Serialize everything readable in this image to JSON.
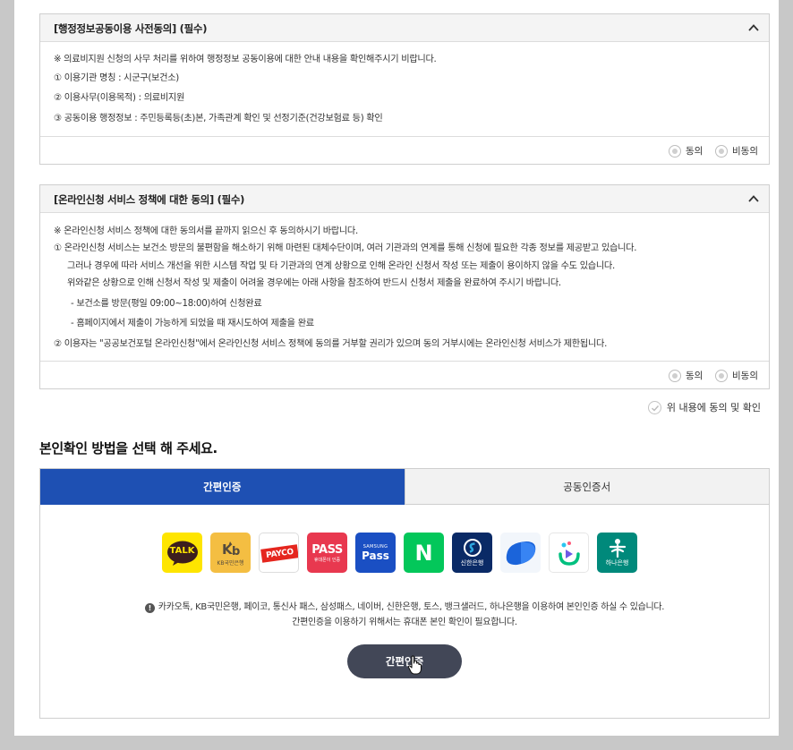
{
  "panel1": {
    "title": "[행정정보공동이용 사전동의] (필수)",
    "lines": [
      "※ 의료비지원 신청의 사무 처리를 위하여 행정정보 공동이용에 대한 안내 내용을 확인해주시기 비랍니다.",
      "①  이용기관 명칭 : 시군구(보건소)",
      "②  이용사무(이용목적) : 의료비지원",
      "③  공동이용 행정정보 : 주민등록등(초)본, 가족관계 확인 및 선정기준(건강보험료 등) 확인"
    ],
    "agree": "동의",
    "disagree": "비동의"
  },
  "panel2": {
    "title": "[온라인신청 서비스 정책에 대한 동의] (필수)",
    "lines": [
      "※ 온라인신청 서비스 정책에 대한 동의서를 끝까지 읽으신 후 동의하시기 바랍니다.",
      "①  온라인신청 서비스는 보건소 방문의 불편함을 해소하기 위해 마련된 대체수단이며, 여러 기관과의 연계를 통해 신청에 필요한 각종 정보를 제공받고 있습니다.",
      "그러나 경우에 따라 서비스 개선을 위한 시스템 작업 및 타 기관과의 연계 상황으로 인해 온라인 신청서 작성 또는 제출이 용이하지 않을 수도 있습니다.",
      "위와같은 상황으로 인해 신청서 작성 및 제출이 어려울 경우에는 아래 사항을 참조하여 반드시 신청서 제출을 완료하여 주시기 바랍니다.",
      "-  보건소를 방문(평일 09:00~18:00)하여 신청완료",
      "-  홈페이지에서 제출이 가능하게 되었을 때 재시도하여 제출을 완료",
      "②  이용자는 \"공공보건포털 온라인신청\"에서 온라인신청 서비스 정책에 동의를 거부할 권리가 있으며 동의 거부시에는 온라인신청 서비스가 제한됩니다."
    ],
    "agree": "동의",
    "disagree": "비동의"
  },
  "confirm_label": "위 내용에 동의 및 확인",
  "section_title": "본인확인 방법을 선택 해 주세요.",
  "tabs": {
    "simple": "간편인증",
    "cert": "공동인증서"
  },
  "providers": {
    "kakao": "TALK",
    "kb": "KB국민은행",
    "payco": "PAYCO",
    "pass": "PASS",
    "pass_sub": "휴대폰이 인증",
    "samsung_top": "SAMSUNG",
    "samsung": "Pass",
    "naver": "N",
    "shinhan": "신한은행",
    "hana": "하나은행"
  },
  "notice": {
    "line1": "카카오톡, KB국민은행, 페이코, 통신사 패스, 삼성패스, 네이버, 신한은행, 토스, 뱅크샐러드, 하나은행을 이용하여 본인인증 하실 수 있습니다.",
    "line2": "간편인증을 이용하기 위해서는 휴대폰 본인 확인이 필요합니다."
  },
  "button_label": "간편인증",
  "colors": {
    "accent": "#1e50b3",
    "button": "#424757"
  }
}
